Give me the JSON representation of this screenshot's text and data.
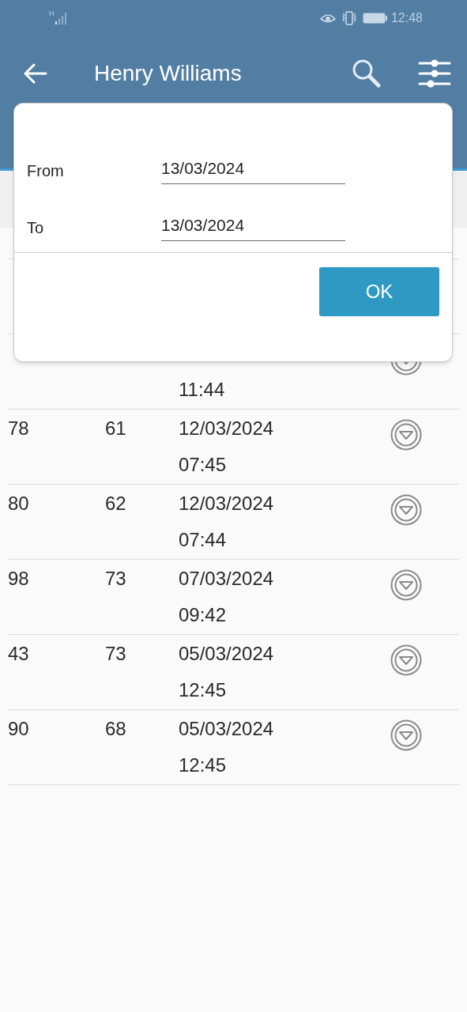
{
  "status_bar": {
    "network": "H",
    "time": "12:48"
  },
  "toolbar": {
    "title": "Henry Williams"
  },
  "table": {
    "rows": [
      {
        "time": "11:44"
      },
      {
        "col1": "78",
        "col2": "61",
        "date": "12/03/2024",
        "time": "07:45"
      },
      {
        "col1": "80",
        "col2": "62",
        "date": "12/03/2024",
        "time": "07:44"
      },
      {
        "col1": "98",
        "col2": "73",
        "date": "07/03/2024",
        "time": "09:42"
      },
      {
        "col1": "43",
        "col2": "73",
        "date": "05/03/2024",
        "time": "12:45"
      },
      {
        "col1": "90",
        "col2": "68",
        "date": "05/03/2024",
        "time": "12:45"
      }
    ]
  },
  "dialog": {
    "fields": [
      {
        "label": "From",
        "value": "13/03/2024"
      },
      {
        "label": "To",
        "value": "13/03/2024"
      }
    ],
    "ok_button": "OK"
  }
}
